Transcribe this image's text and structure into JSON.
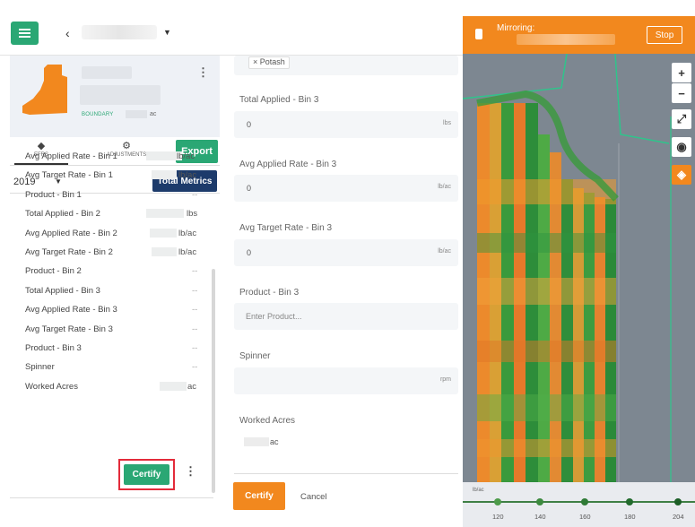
{
  "toolbar": {
    "menu_icon": "hamburger-menu-icon",
    "back_icon": "chevron-left-icon",
    "field_dropdown_icon": "caret-down-icon"
  },
  "mirroring": {
    "label": "Mirroring:",
    "stop_label": "Stop",
    "bg_color": "#f2881e"
  },
  "field_card": {
    "boundary_label": "BOUNDARY",
    "boundary_unit": "ac"
  },
  "tabs": [
    {
      "label": "EFRS",
      "icon": "layers-stack-icon"
    },
    {
      "label": "ADJUSTMENTS",
      "icon": "gear-icon"
    }
  ],
  "export_label": "Export",
  "year": {
    "value": "2019"
  },
  "total_metrics_label": "Total Metrics",
  "metrics": [
    {
      "name": "Avg Applied Rate - Bin 1",
      "unit": "lb/ac"
    },
    {
      "name": "Avg Target Rate - Bin 1",
      "unit": "lb/ac"
    },
    {
      "name": "Product - Bin 1",
      "unit": "--"
    },
    {
      "name": "Total Applied - Bin 2",
      "unit": "lbs"
    },
    {
      "name": "Avg Applied Rate - Bin 2",
      "unit": "lb/ac"
    },
    {
      "name": "Avg Target Rate - Bin 2",
      "unit": "lb/ac"
    },
    {
      "name": "Product - Bin 2",
      "unit": "--"
    },
    {
      "name": "Total Applied - Bin 3",
      "unit": "--"
    },
    {
      "name": "Avg Applied Rate - Bin 3",
      "unit": "--"
    },
    {
      "name": "Avg Target Rate - Bin 3",
      "unit": "--"
    },
    {
      "name": "Product - Bin 3",
      "unit": "--"
    },
    {
      "name": "Spinner",
      "unit": "--"
    },
    {
      "name": "Worked Acres",
      "unit": "ac"
    }
  ],
  "certify_label": "Certify",
  "form": {
    "product_chip": "× Potash",
    "total_applied_bin3": {
      "label": "Total Applied - Bin 3",
      "value": "0",
      "unit": "lbs"
    },
    "avg_applied_bin3": {
      "label": "Avg Applied Rate - Bin 3",
      "value": "0",
      "unit": "lb/ac"
    },
    "avg_target_bin3": {
      "label": "Avg Target Rate - Bin 3",
      "value": "0",
      "unit": "lb/ac"
    },
    "product_bin3": {
      "label": "Product - Bin 3",
      "placeholder": "Enter Product..."
    },
    "spinner": {
      "label": "Spinner",
      "unit": "rpm"
    },
    "worked_acres": {
      "label": "Worked Acres",
      "unit": "ac"
    },
    "certify_label": "Certify",
    "cancel_label": "Cancel"
  },
  "map": {
    "zoom_in": "+",
    "zoom_out": "−",
    "legend_unit": "lb/ac",
    "legend_ticks": [
      "120",
      "140",
      "160",
      "180",
      "204"
    ]
  }
}
